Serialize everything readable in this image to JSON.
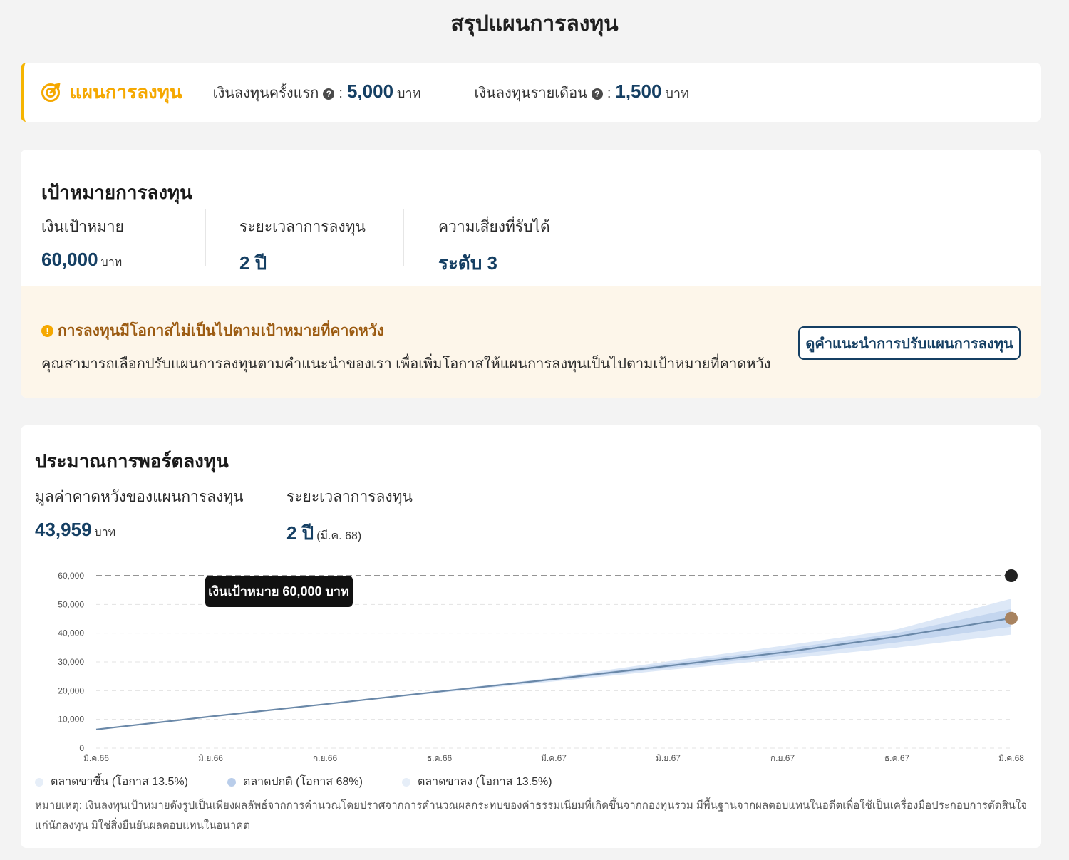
{
  "page_title": "สรุปแผนการลงทุน",
  "plan": {
    "title": "แผนการลงทุน",
    "initial_label": "เงินลงทุนครั้งแรก",
    "initial_value": "5,000",
    "monthly_label": "เงินลงทุนรายเดือน",
    "monthly_value": "1,500",
    "unit": "บาท",
    "colon": ":",
    "help_glyph": "?",
    "icon": "target-arrow-icon"
  },
  "goal": {
    "title": "เป้าหมายการลงทุน",
    "target_label": "เงินเป้าหมาย",
    "target_value": "60,000",
    "target_unit": "บาท",
    "duration_label": "ระยะเวลาการลงทุน",
    "duration_value": "2 ปี",
    "risk_label": "ความเสี่ยงที่รับได้",
    "risk_value": "ระดับ 3"
  },
  "warning": {
    "icon_glyph": "!",
    "title": "การลงทุนมีโอกาสไม่เป็นไปตามเป้าหมายที่คาดหวัง",
    "text": "คุณสามารถเลือกปรับแผนการลงทุนตามคำแนะนำของเรา เพื่อเพิ่มโอกาสให้แผนการลงทุนเป็นไปตามเป้าหมายที่คาดหวัง",
    "button_label": "ดูคำแนะนำการปรับแผนการลงทุน"
  },
  "portfolio": {
    "title": "ประมาณการพอร์ตลงทุน",
    "expected_label": "มูลค่าคาดหวังของแผนการลงทุน",
    "expected_value": "43,959",
    "expected_unit": "บาท",
    "duration_label": "ระยะเวลาการลงทุน",
    "duration_value": "2 ปี",
    "duration_note": "(มี.ค. 68)",
    "legend": [
      {
        "label": "ตลาดขาขึ้น (โอกาส 13.5%)",
        "color": "#e6eef8"
      },
      {
        "label": "ตลาดปกติ (โอกาส 68%)",
        "color": "#b9cdea"
      },
      {
        "label": "ตลาดขาลง (โอกาส 13.5%)",
        "color": "#e6eef8"
      }
    ],
    "note": "หมายเหตุ: เงินลงทุนเป้าหมายดังรูปเป็นเพียงผลลัพธ์จากการคำนวณโดยปราศจากการคำนวณผลกระทบของค่าธรรมเนียมที่เกิดขึ้นจากกองทุนรวม มีพื้นฐานจากผลตอบแทนในอดีตเพื่อใช้เป็นเครื่องมือประกอบการตัดสินใจแก่นักลงทุน มิใช่สิ่งยืนยันผลตอบแทนในอนาคต"
  },
  "chart_data": {
    "type": "area",
    "x_labels": [
      "มี.ค.66",
      "มิ.ย.66",
      "ก.ย.66",
      "ธ.ค.66",
      "มี.ค.67",
      "มิ.ย.67",
      "ก.ย.67",
      "ธ.ค.67",
      "มี.ค.68"
    ],
    "y_ticks": [
      0,
      10000,
      20000,
      30000,
      40000,
      50000,
      60000
    ],
    "y_tick_labels": [
      "0",
      "10,000",
      "20,000",
      "30,000",
      "40,000",
      "50,000",
      "60,000"
    ],
    "ylim": [
      0,
      60000
    ],
    "grid": true,
    "target": {
      "value": 60000,
      "label": "เงินเป้าหมาย 60,000 บาท",
      "color": "#222222"
    },
    "series": [
      {
        "name": "ตลาดขาขึ้น (โอกาส 13.5%)",
        "role": "outer_upper",
        "values": [
          6500,
          11000,
          15300,
          20000,
          24500,
          30200,
          35600,
          41300,
          52000
        ],
        "color": "#dde8f7"
      },
      {
        "name": "ตลาดปกติ (โอกาส 68%)",
        "role": "median",
        "values": [
          6500,
          11000,
          15300,
          19700,
          24000,
          28600,
          33300,
          38800,
          45200
        ],
        "color": "#6a88a8"
      },
      {
        "name": "ตลาดขาลง (โอกาส 13.5%)",
        "role": "outer_lower",
        "values": [
          6500,
          10900,
          15100,
          19300,
          23200,
          27200,
          31000,
          35000,
          39500
        ],
        "color": "#dde8f7"
      },
      {
        "name": "",
        "role": "inner_upper",
        "values": [
          6500,
          11000,
          15250,
          19850,
          24250,
          29400,
          34400,
          40000,
          48400
        ],
        "color": "#c4d6ef"
      },
      {
        "name": "",
        "role": "inner_lower",
        "values": [
          6500,
          10950,
          15200,
          19500,
          23600,
          27900,
          32100,
          36800,
          42200
        ],
        "color": "#c4d6ef"
      }
    ],
    "end_marker_color": "#a88360"
  }
}
